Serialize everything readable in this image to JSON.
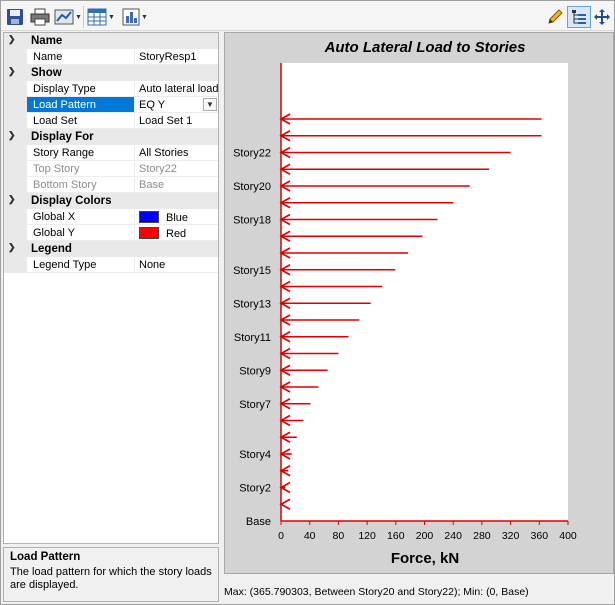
{
  "toolbar": {
    "buttons": [
      {
        "icon": "save-icon"
      },
      {
        "icon": "print-icon"
      },
      {
        "icon": "display-options-icon"
      },
      {
        "icon": "table-icon"
      },
      {
        "icon": "chart-icon"
      },
      {
        "icon": "pencil-icon"
      },
      {
        "icon": "tree-view-icon"
      },
      {
        "icon": "move-icon"
      }
    ]
  },
  "grid": {
    "categories": [
      {
        "label": "Name"
      },
      {
        "label": "Show"
      },
      {
        "label": "Display For"
      },
      {
        "label": "Display Colors"
      },
      {
        "label": "Legend"
      }
    ],
    "props": {
      "name": {
        "label": "Name",
        "value": "StoryResp1"
      },
      "display_type": {
        "label": "Display Type",
        "value": "Auto lateral loads"
      },
      "load_pattern": {
        "label": "Load Pattern",
        "value": "EQ Y"
      },
      "load_set": {
        "label": "Load Set",
        "value": "Load Set 1"
      },
      "story_range": {
        "label": "Story Range",
        "value": "All Stories"
      },
      "top_story": {
        "label": "Top Story",
        "value": "Story22"
      },
      "bottom_story": {
        "label": "Bottom Story",
        "value": "Base"
      },
      "global_x": {
        "label": "Global X",
        "value": "Blue",
        "color": "#0000ff"
      },
      "global_y": {
        "label": "Global Y",
        "value": "Red",
        "color": "#ff0000"
      },
      "legend_type": {
        "label": "Legend Type",
        "value": "None"
      }
    }
  },
  "help": {
    "title": "Load Pattern",
    "description": "The load pattern for which the story loads are displayed."
  },
  "status": {
    "text": "Max: (365.790303, Between Story20 and Story22);   Min: (0, Base)"
  },
  "chart_data": {
    "type": "bar",
    "orientation": "horizontal",
    "title": "Auto Lateral Load to Stories",
    "xlabel": "Force, kN",
    "ylabel": "",
    "xlim": [
      0,
      400
    ],
    "xticks": [
      "0",
      "40",
      "80",
      "120",
      "160",
      "200",
      "240",
      "280",
      "320",
      "360",
      "400"
    ],
    "levels": 23,
    "story_labels": [
      {
        "label": "Base",
        "level": 0
      },
      {
        "label": "Story2",
        "level": 2
      },
      {
        "label": "Story4",
        "level": 4
      },
      {
        "label": "Story7",
        "level": 7
      },
      {
        "label": "Story9",
        "level": 9
      },
      {
        "label": "Story11",
        "level": 11
      },
      {
        "label": "Story13",
        "level": 13
      },
      {
        "label": "Story15",
        "level": 15
      },
      {
        "label": "Story18",
        "level": 18
      },
      {
        "label": "Story20",
        "level": 20
      },
      {
        "label": "Story22",
        "level": 22
      }
    ],
    "forces": [
      0,
      2,
      6,
      10,
      15,
      22,
      31,
      41,
      52,
      65,
      80,
      94,
      109,
      125,
      141,
      159,
      177,
      197,
      218,
      240,
      263,
      290,
      320,
      363,
      363
    ],
    "bar_color": "#e00000",
    "grid": false
  }
}
